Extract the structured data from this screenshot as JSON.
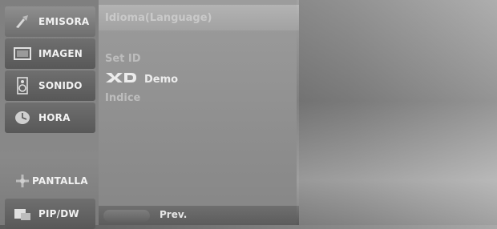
{
  "menu": {
    "items": [
      {
        "label": "EMISORA",
        "icon": "antenna-icon",
        "selected": true
      },
      {
        "label": "IMAGEN",
        "icon": "monitor-icon",
        "selected": false
      },
      {
        "label": "SONIDO",
        "icon": "speaker-icon",
        "selected": false
      },
      {
        "label": "HORA",
        "icon": "clock-icon",
        "selected": false
      },
      {
        "label": "PANTALLA",
        "icon": "screen-adjust-icon",
        "selected": false
      },
      {
        "label": "PIP/DW",
        "icon": "pip-icon",
        "selected": false
      }
    ]
  },
  "submenu": {
    "items": [
      {
        "label": "Idioma(Language)"
      },
      {
        "label": "Set ID"
      },
      {
        "label": "Demo",
        "logo": "XD"
      },
      {
        "label": "Indice"
      }
    ]
  },
  "footer": {
    "prev_label": "Prev."
  },
  "colors": {
    "panel": "#9c9c9c",
    "menu": "#585858",
    "text": "#ececec"
  }
}
